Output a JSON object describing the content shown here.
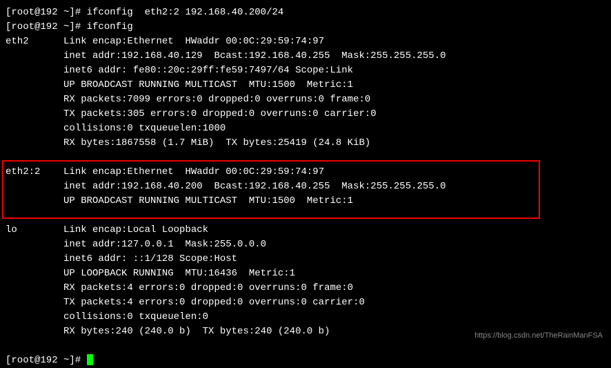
{
  "prompt1": "[root@192 ~]# ",
  "cmd1": "ifconfig  eth2:2 192.168.40.200/24",
  "prompt2": "[root@192 ~]# ",
  "cmd2": "ifconfig",
  "eth2": {
    "name": "eth2",
    "l1": "Link encap:Ethernet  HWaddr 00:0C:29:59:74:97",
    "l2": "inet addr:192.168.40.129  Bcast:192.168.40.255  Mask:255.255.255.0",
    "l3": "inet6 addr: fe80::20c:29ff:fe59:7497/64 Scope:Link",
    "l4": "UP BROADCAST RUNNING MULTICAST  MTU:1500  Metric:1",
    "l5": "RX packets:7099 errors:0 dropped:0 overruns:0 frame:0",
    "l6": "TX packets:305 errors:0 dropped:0 overruns:0 carrier:0",
    "l7": "collisions:0 txqueuelen:1000",
    "l8": "RX bytes:1867558 (1.7 MiB)  TX bytes:25419 (24.8 KiB)"
  },
  "eth22": {
    "name": "eth2:2",
    "l1": "Link encap:Ethernet  HWaddr 00:0C:29:59:74:97",
    "l2": "inet addr:192.168.40.200  Bcast:192.168.40.255  Mask:255.255.255.0",
    "l3": "UP BROADCAST RUNNING MULTICAST  MTU:1500  Metric:1"
  },
  "lo": {
    "name": "lo",
    "l1": "Link encap:Local Loopback",
    "l2": "inet addr:127.0.0.1  Mask:255.0.0.0",
    "l3": "inet6 addr: ::1/128 Scope:Host",
    "l4": "UP LOOPBACK RUNNING  MTU:16436  Metric:1",
    "l5": "RX packets:4 errors:0 dropped:0 overruns:0 frame:0",
    "l6": "TX packets:4 errors:0 dropped:0 overruns:0 carrier:0",
    "l7": "collisions:0 txqueuelen:0",
    "l8": "RX bytes:240 (240.0 b)  TX bytes:240 (240.0 b)"
  },
  "prompt3": "[root@192 ~]# ",
  "indent": "          ",
  "watermark": "https://blog.csdn.net/TheRainManFSA"
}
